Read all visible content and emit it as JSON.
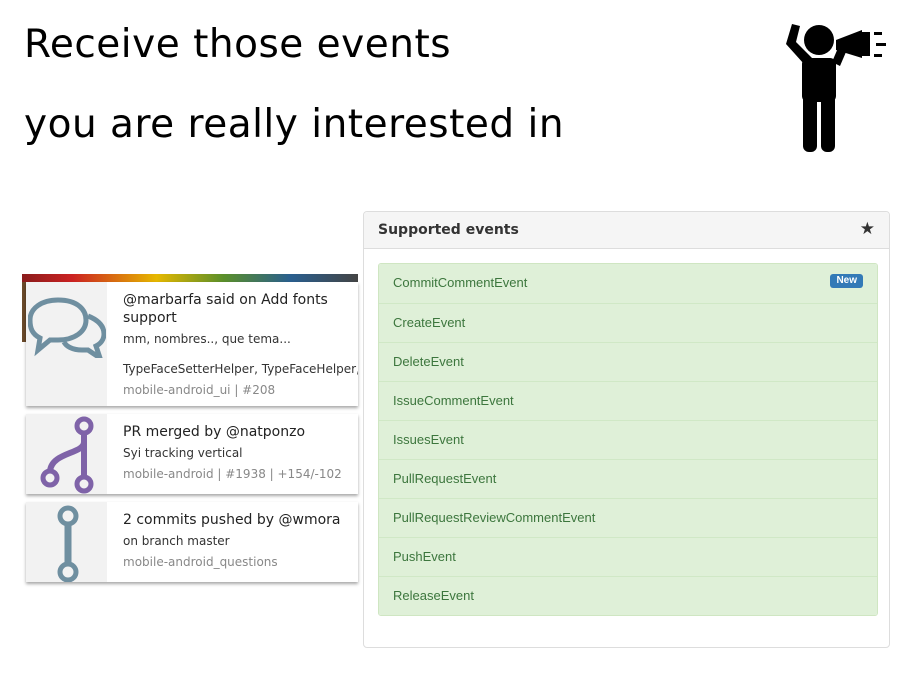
{
  "heading": {
    "line1": "Receive those events",
    "line2": "you are really interested in"
  },
  "icons": {
    "megaphone": "person-with-megaphone-icon",
    "comment": "speech-bubbles-icon",
    "merge": "git-merge-icon",
    "commit": "git-commit-icon",
    "star": "star-icon"
  },
  "notifications": [
    {
      "headline": "@marbarfa said on Add fonts",
      "headline2": "support",
      "body": "mm, nombres.., que tema...",
      "body2": "TypeFaceSetterHelper, TypeFaceHelper,..",
      "meta": "mobile-android_ui | #208"
    },
    {
      "headline": "PR merged by @natponzo",
      "body": "Syi tracking vertical",
      "meta": "mobile-android | #1938 | +154/-102"
    },
    {
      "headline": "2 commits pushed by @wmora",
      "body": "on branch master",
      "meta": "mobile-android_questions"
    }
  ],
  "panel": {
    "title": "Supported events",
    "star": "★",
    "events": [
      {
        "label": "CommitCommentEvent",
        "badge": "New"
      },
      {
        "label": "CreateEvent"
      },
      {
        "label": "DeleteEvent"
      },
      {
        "label": "IssueCommentEvent"
      },
      {
        "label": "IssuesEvent"
      },
      {
        "label": "PullRequestEvent"
      },
      {
        "label": "PullRequestReviewCommentEvent"
      },
      {
        "label": "PushEvent"
      },
      {
        "label": "ReleaseEvent"
      }
    ]
  },
  "colors": {
    "event_bg": "#dff0d8",
    "event_text": "#3c763d",
    "badge_bg": "#337ab7",
    "comment_icon": "#6f8fa0",
    "merge_icon": "#7f63a8",
    "commit_icon": "#6f8fa0"
  }
}
